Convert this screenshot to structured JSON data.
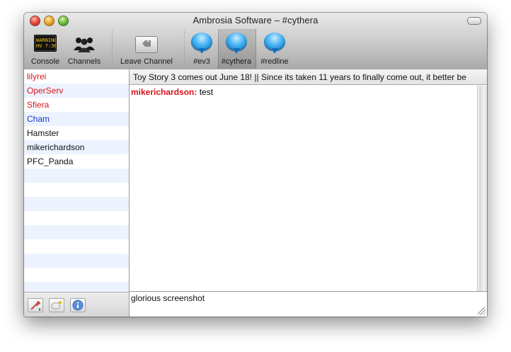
{
  "window": {
    "title": "Ambrosia Software – #cythera"
  },
  "toolbar": {
    "console_label": "Console",
    "console_screen_text": "WARNING\nHV 7:36 I",
    "channels_label": "Channels",
    "leave_label": "Leave Channel",
    "channel_tabs": [
      {
        "label": "#ev3"
      },
      {
        "label": "#cythera"
      },
      {
        "label": "#redline"
      }
    ]
  },
  "users": [
    {
      "name": "lilyrei",
      "color": "#d8141b"
    },
    {
      "name": "OperServ",
      "color": "#d8141b"
    },
    {
      "name": "Sfiera",
      "color": "#d8141b"
    },
    {
      "name": "Cham",
      "color": "#1535c8"
    },
    {
      "name": "Hamster",
      "color": "#111111"
    },
    {
      "name": "mikerichardson",
      "color": "#111111"
    },
    {
      "name": "PFC_Panda",
      "color": "#111111"
    }
  ],
  "topic": "Toy Story 3 comes out June 18! || Since its taken 11 years to finally come out, it better be",
  "messages": [
    {
      "nick": "mikerichardson:",
      "text": " test"
    }
  ],
  "input": {
    "value": "glorious screenshot"
  }
}
